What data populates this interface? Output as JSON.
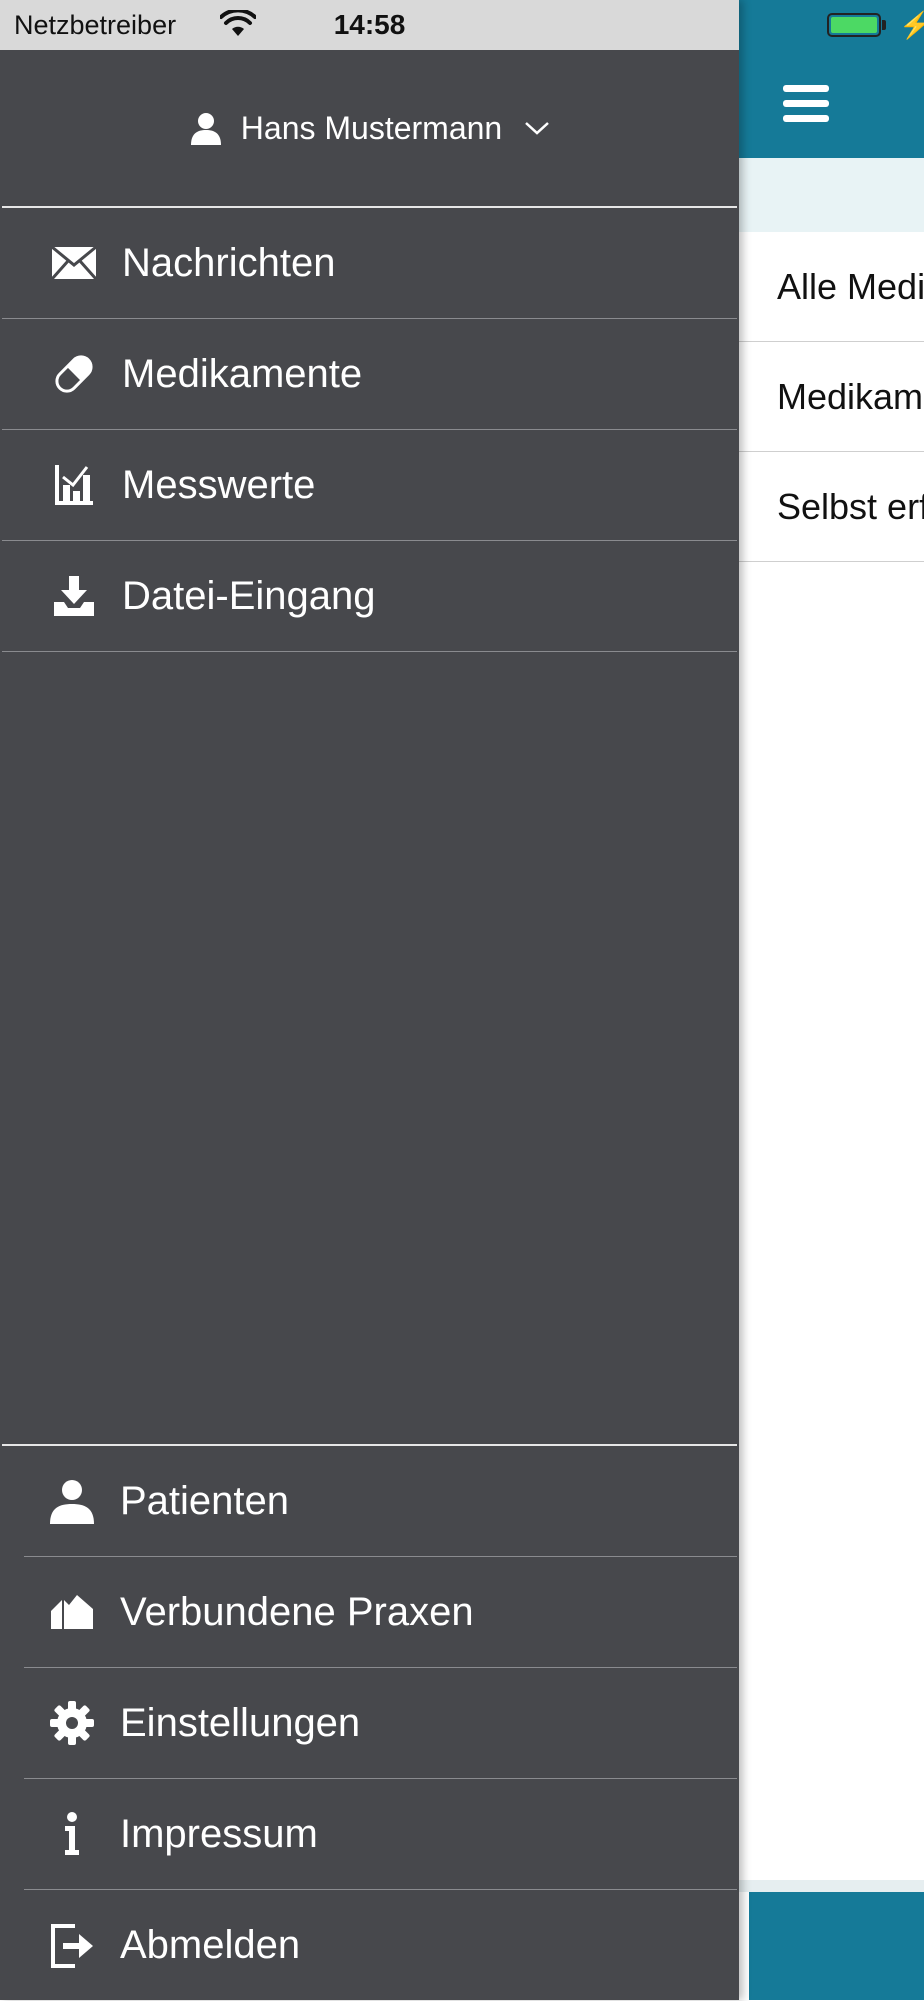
{
  "statusbar": {
    "carrier": "Netzbetreiber",
    "time": "14:58",
    "battery_color": "#4cd964"
  },
  "drawer": {
    "user": {
      "name": "Hans Mustermann",
      "icon": "user-icon",
      "toggle_icon": "chevron-down-icon"
    },
    "items": [
      {
        "label": "Nachrichten",
        "icon": "envelope-icon"
      },
      {
        "label": "Medikamente",
        "icon": "pill-icon"
      },
      {
        "label": "Messwerte",
        "icon": "chart-icon"
      },
      {
        "label": "Datei-Eingang",
        "icon": "download-tray-icon"
      }
    ],
    "secondary_items": [
      {
        "label": "Patienten",
        "icon": "person-icon"
      },
      {
        "label": "Verbundene Praxen",
        "icon": "practice-icon"
      },
      {
        "label": "Einstellungen",
        "icon": "gear-icon"
      },
      {
        "label": "Impressum",
        "icon": "info-icon"
      },
      {
        "label": "Abmelden",
        "icon": "logout-icon"
      }
    ]
  },
  "content": {
    "rows": [
      "Alle Medikamente",
      "Medikamente",
      "Selbst erfasst"
    ],
    "accent_color": "#157a98"
  }
}
